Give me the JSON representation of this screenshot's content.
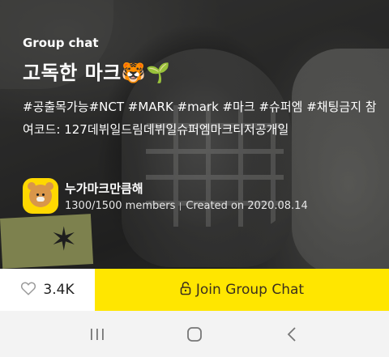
{
  "header": {
    "kind_label": "Group chat",
    "title": "고독한 마크🐯🌱"
  },
  "description": {
    "hashtags": "#공출목가능#NCT #MARK #mark #마크 #슈퍼엠 #채팅금지   참여코드: 127데뷔일드림데뷔일슈퍼엠마크티저공개일"
  },
  "owner": {
    "name": "누가마크만큼해",
    "members": "1300/1500 members",
    "created": "Created on 2020.08.14",
    "avatar_icon": "ryan-character-icon"
  },
  "actions": {
    "like_count": "3.4K",
    "join_label": "Join Group Chat",
    "heart_icon": "heart-outline-icon",
    "lock_icon": "padlock-icon"
  },
  "nav": {
    "icons": [
      "recent-apps-icon",
      "home-icon",
      "back-icon"
    ]
  },
  "colors": {
    "join_background": "#ffe600",
    "avatar_background": "#ffd800"
  }
}
